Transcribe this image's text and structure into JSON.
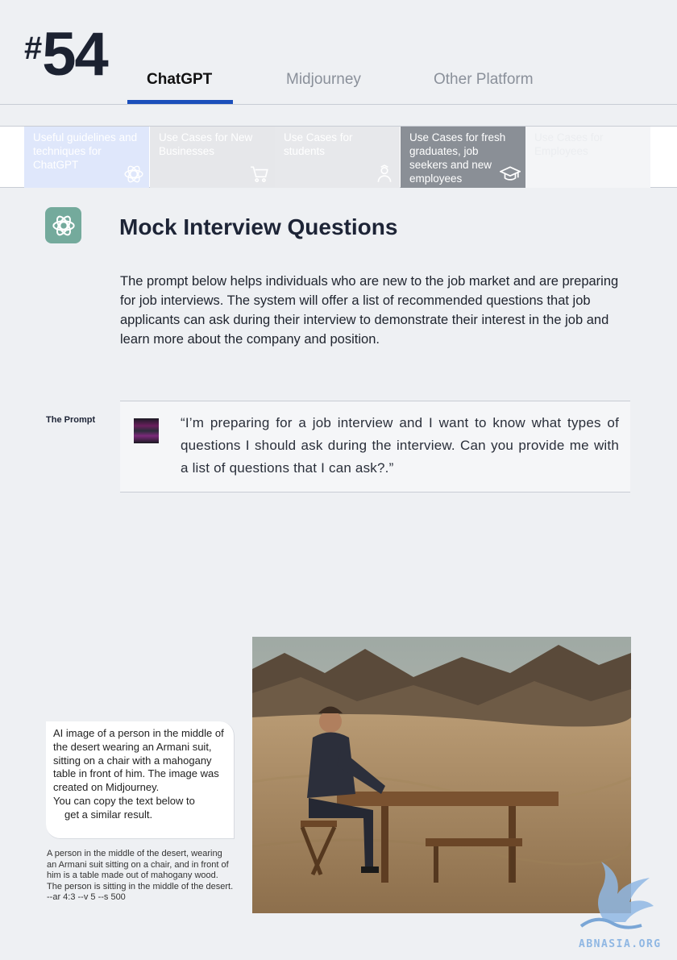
{
  "page": {
    "hash": "#",
    "number": "54"
  },
  "top_tabs": [
    {
      "label": "ChatGPT",
      "active": true
    },
    {
      "label": "Midjourney",
      "active": false
    },
    {
      "label": "Other Platform",
      "active": false
    }
  ],
  "categories": [
    {
      "label": "Useful guidelines and techniques for ChatGPT",
      "icon": "chatgpt-icon"
    },
    {
      "label": "Use Cases for New Businesses",
      "icon": "cart-icon"
    },
    {
      "label": "Use Cases for students",
      "icon": "student-icon"
    },
    {
      "label": "Use Cases for fresh graduates, job seekers and new employees",
      "icon": "graduation-cap-icon"
    },
    {
      "label": "Use Cases for Employees",
      "icon": ""
    }
  ],
  "section": {
    "title": "Mock Interview Questions",
    "intro": "The prompt below helps individuals who are new to the job market and are preparing for job interviews. The system will offer a list of recommended questions that job applicants can ask during their interview to demonstrate their interest in the job and learn more about the company and position."
  },
  "prompt": {
    "label": "The Prompt",
    "text": "“I’m preparing for a job interview and I want to know what types of questions I should ask during the interview. Can you provide me with a list of questions that I can ask?.”"
  },
  "image_caption": {
    "line1": "AI image of a person in the middle of the desert wearing an Armani suit, sitting on a chair with a mahogany table in front of him. The image was created on Midjourney.",
    "line2": "You can copy the text below to",
    "line3": "get a similar result."
  },
  "midjourney_prompt": "A person in the middle of the desert, wearing an Armani suit sitting on a chair, and in front of him is a table made out of mahogany wood. The person is sitting in the middle of the desert. --ar 4:3 --v 5 --s 500",
  "watermark": "ABNASIA.ORG",
  "colors": {
    "accent": "#1b4fbb",
    "chatgpt_green": "#74aa9c",
    "active_category": "#8a8f96"
  }
}
